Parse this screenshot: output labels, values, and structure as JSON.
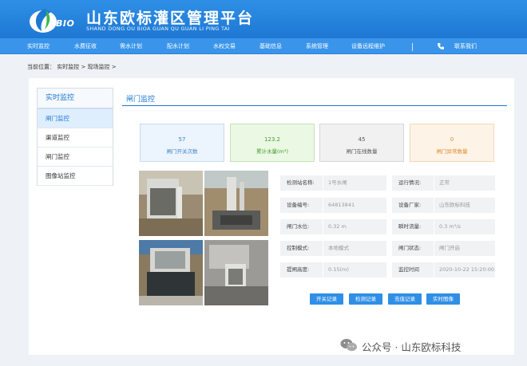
{
  "header": {
    "logo_text": "BIO",
    "title_cn": "山东欧标灌区管理平台",
    "title_en": "SHAND DONG OU BIOA GUAN QU GUAN LI PING TAI"
  },
  "nav": {
    "items": [
      "实时监控",
      "水费征收",
      "需水计划",
      "配水计划",
      "水权交易",
      "基础信息",
      "系统管理",
      "设备远程维护"
    ],
    "contact": "联系我们"
  },
  "breadcrumb": "当前位置： 实时监控 > 现场监控 >",
  "sidebar": {
    "header": "实时监控",
    "items": [
      "闸门监控",
      "渠道监控",
      "闸门监控",
      "图像站监控"
    ]
  },
  "main": {
    "title": "闸门监控"
  },
  "stats": [
    {
      "value": "57",
      "label": "闸门开关次数"
    },
    {
      "value": "123.2",
      "label": "累计水量(m³)"
    },
    {
      "value": "45",
      "label": "闸门在线数量"
    },
    {
      "value": "0",
      "label": "闸门异常数量"
    }
  ],
  "info": [
    {
      "l1": "检测站名称:",
      "v1": "1号水闸",
      "l2": "运行情况:",
      "v2": "正常"
    },
    {
      "l1": "设备编号:",
      "v1": "64813841",
      "l2": "设备厂家:",
      "v2": "山东欧标科技"
    },
    {
      "l1": "闸门水位:",
      "v1": "0.32 m",
      "l2": "瞬时流量:",
      "v2": "0.3 m³/s"
    },
    {
      "l1": "控制模式:",
      "v1": "本地模式",
      "l2": "闸门状态:",
      "v2": "闸门开启"
    },
    {
      "l1": "提闸高度:",
      "v1": "0.15(m)",
      "l2": "监控时间",
      "v2": "2020-10-22 15:20:00"
    }
  ],
  "buttons": [
    "开关记录",
    "检测记录",
    "充值记录",
    "实时图像"
  ],
  "watermark": "公众号 · 山东欧标科技",
  "colors": {
    "primary": "#1d78d3",
    "header_bg": "#2f8fe6",
    "stat_blue": "#3e84c9",
    "stat_green": "#4a9b2a",
    "stat_gray": "#555555",
    "stat_orange": "#e08a2a"
  },
  "icons": [
    "logo-leaf-icon",
    "phone-icon",
    "wechat-icon"
  ]
}
